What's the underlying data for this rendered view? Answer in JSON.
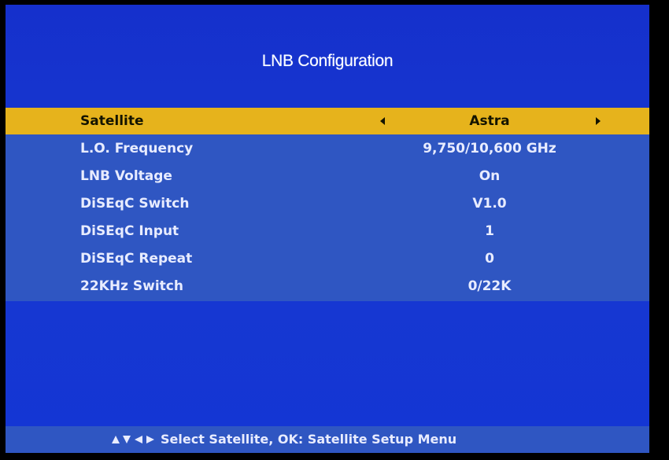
{
  "title": "LNB Configuration",
  "menu": {
    "items": [
      {
        "label": "Satellite",
        "value": "Astra"
      },
      {
        "label": "L.O. Frequency",
        "value": "9,750/10,600 GHz"
      },
      {
        "label": "LNB Voltage",
        "value": "On"
      },
      {
        "label": "DiSEqC Switch",
        "value": "V1.0"
      },
      {
        "label": "DiSEqC Input",
        "value": "1"
      },
      {
        "label": "DiSEqC Repeat",
        "value": "0"
      },
      {
        "label": "22KHz Switch",
        "value": "0/22K"
      }
    ],
    "selected_index": 0
  },
  "footer": {
    "icons": [
      "up-arrow-icon",
      "down-arrow-icon",
      "left-arrow-icon",
      "right-arrow-icon"
    ],
    "hint": "Select Satellite, OK: Satellite Setup Menu"
  },
  "colors": {
    "background": "#1738d0",
    "panel": "#2f56c2",
    "highlight": "#e6b31c",
    "text": "#e8ecff"
  }
}
